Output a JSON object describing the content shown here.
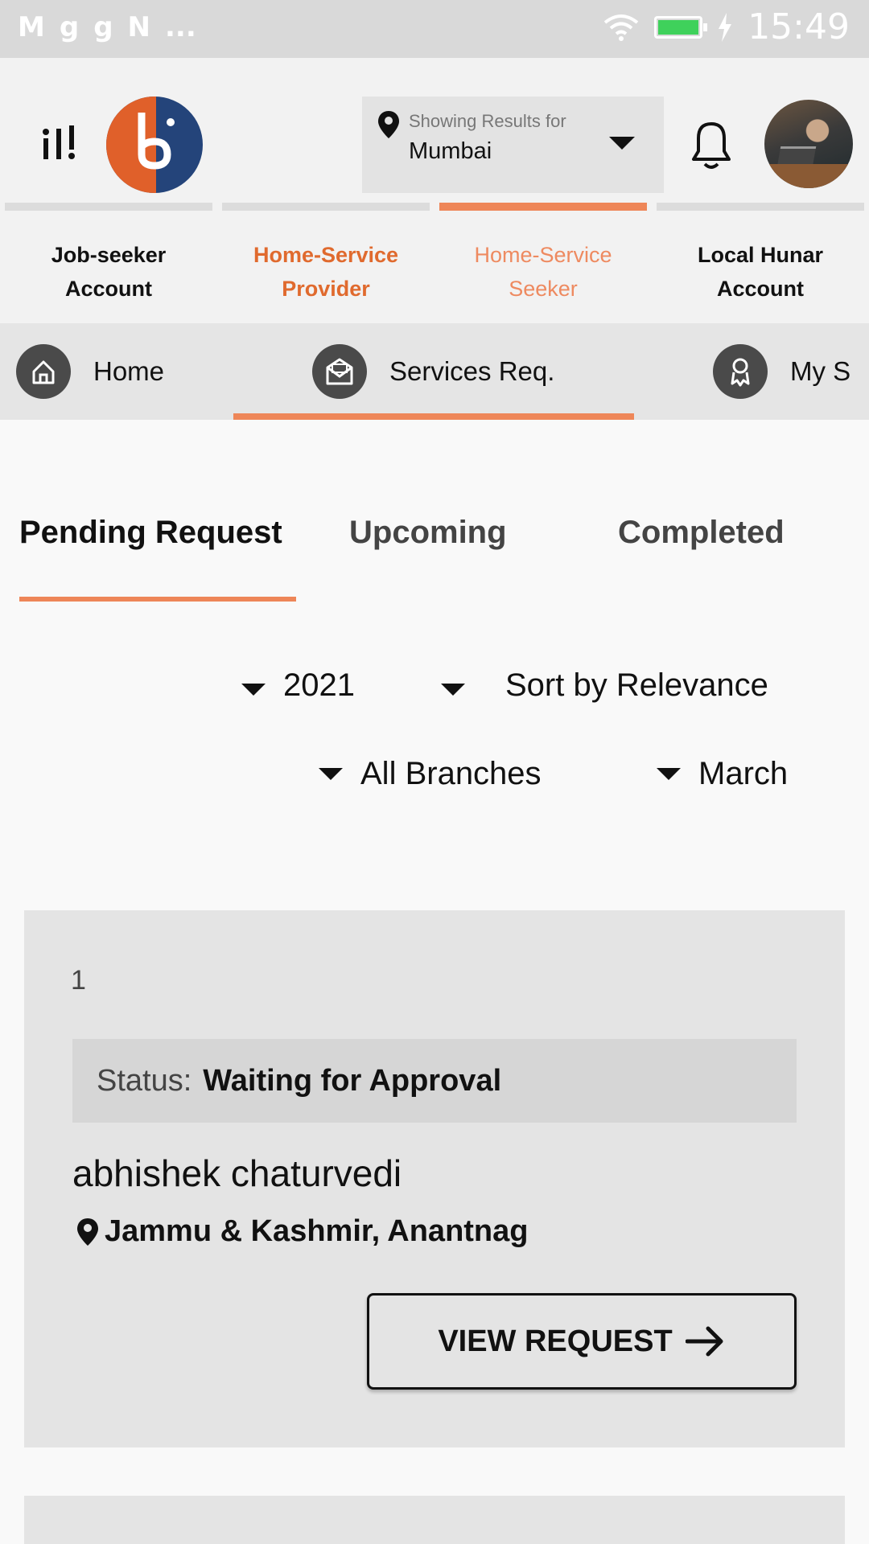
{
  "status_bar": {
    "notif_icons": [
      "M",
      "g",
      "g",
      "N",
      "..."
    ],
    "time": "15:49"
  },
  "header": {
    "location_label": "Showing Results for",
    "location_city": "Mumbai"
  },
  "account_tabs": [
    {
      "line1": "Job-seeker",
      "line2": "Account"
    },
    {
      "line1": "Home-Service",
      "line2": "Provider"
    },
    {
      "line1": "Home-Service",
      "line2": "Seeker"
    },
    {
      "line1": "Local Hunar",
      "line2": "Account"
    }
  ],
  "section_nav": [
    {
      "label": "Home",
      "icon": "home-icon"
    },
    {
      "label": "Services Req.",
      "icon": "mail-icon"
    },
    {
      "label": "My S",
      "icon": "user-icon"
    }
  ],
  "subtabs": [
    "Pending Request",
    "Upcoming",
    "Completed"
  ],
  "filters": {
    "year": "2021",
    "sort": "Sort by Relevance",
    "branch": "All Branches",
    "month": "March"
  },
  "request": {
    "index": "1",
    "status_key": "Status:",
    "status_value": "Waiting for Approval",
    "name": "abhishek chaturvedi",
    "location": "Jammu & Kashmir, Anantnag",
    "button_label": "VIEW REQUEST"
  },
  "colors": {
    "accent": "#ee8658",
    "accent_text": "#e06a2e",
    "logo_blue": "#24447a",
    "logo_orange": "#e0602a"
  }
}
